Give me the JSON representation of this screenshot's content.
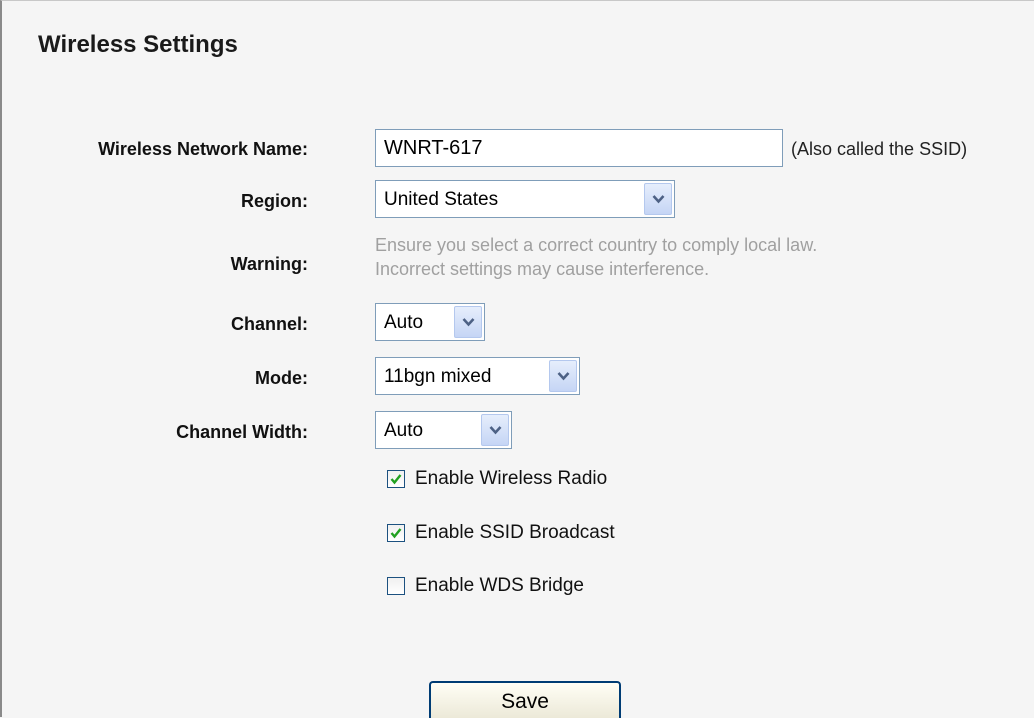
{
  "page": {
    "title": "Wireless Settings"
  },
  "form": {
    "ssid": {
      "label": "Wireless Network Name:",
      "value": "WNRT-617",
      "hint": "(Also called the SSID)"
    },
    "region": {
      "label": "Region:",
      "value": "United States"
    },
    "warning": {
      "label": "Warning:",
      "line1": "Ensure you select a correct country to comply local law.",
      "line2": "Incorrect settings may cause interference."
    },
    "channel": {
      "label": "Channel:",
      "value": "Auto"
    },
    "mode": {
      "label": "Mode:",
      "value": "11bgn mixed"
    },
    "channel_width": {
      "label": "Channel Width:",
      "value": "Auto"
    },
    "checkboxes": [
      {
        "label": "Enable Wireless Radio",
        "checked": true
      },
      {
        "label": "Enable SSID Broadcast",
        "checked": true
      },
      {
        "label": "Enable WDS Bridge",
        "checked": false
      }
    ],
    "save_label": "Save"
  },
  "colors": {
    "check": "#21a121",
    "warning_text": "#a0a0a0",
    "input_border": "#7f9db9"
  },
  "icons": {
    "dropdown": "chevron-down-icon",
    "check": "checkmark-icon"
  }
}
